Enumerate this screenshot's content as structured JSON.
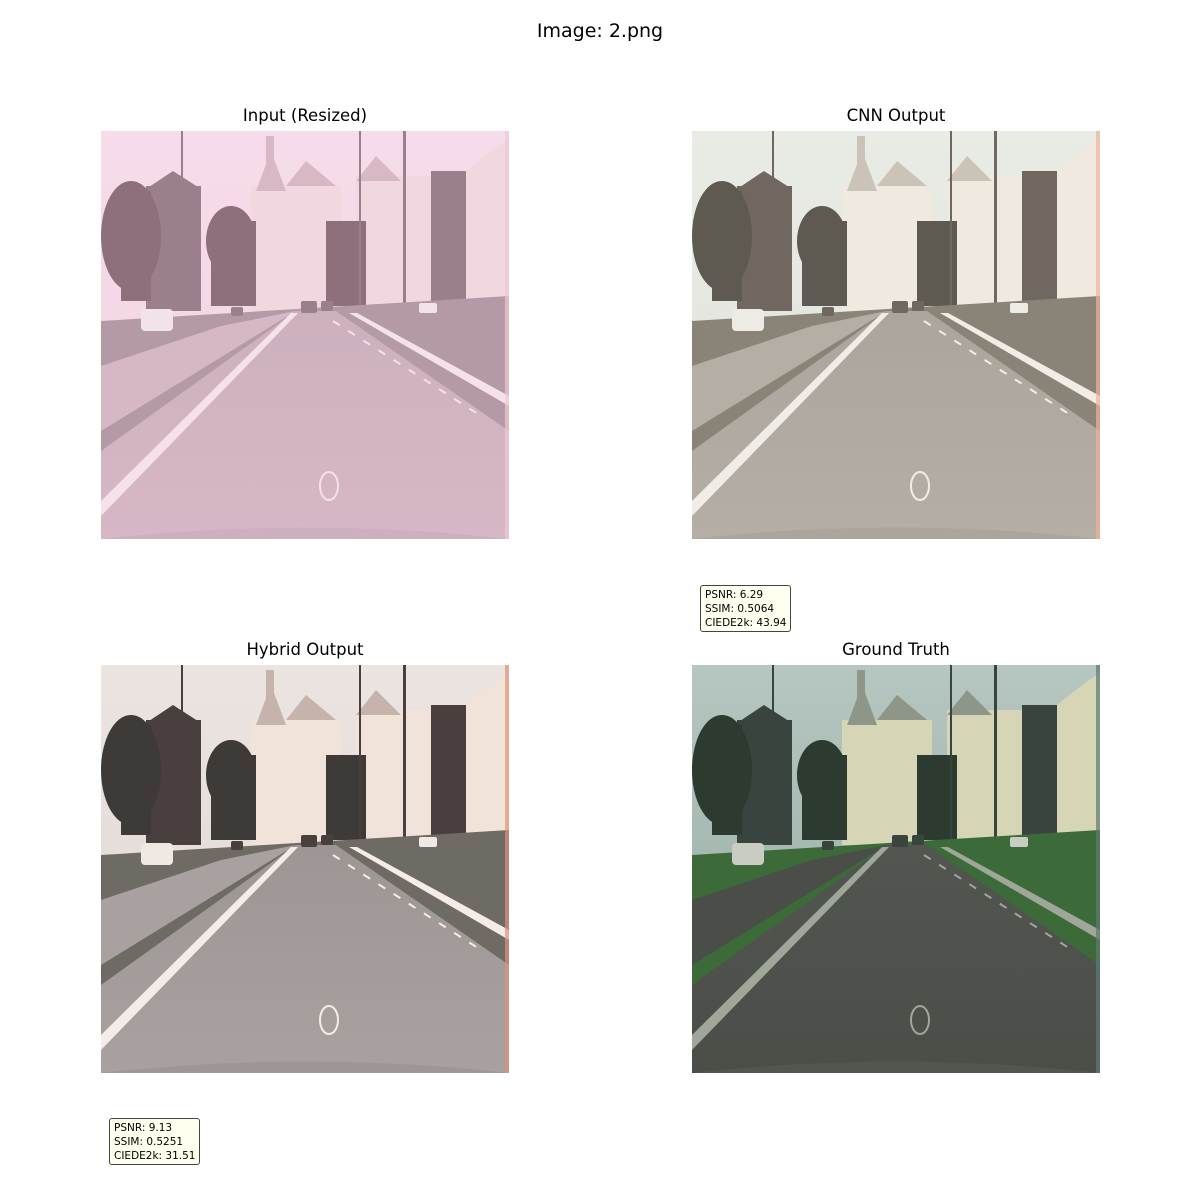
{
  "figure": {
    "title": "Image: 2.png"
  },
  "panels": [
    {
      "title": "Input (Resized)",
      "palette": {
        "sky": "#f6dcea",
        "sky2": "#f3d2e2",
        "road": "#d6b7c6",
        "road_far": "#cdb0be",
        "grass": "#b49aa6",
        "bld1": "#f0d7e0",
        "bld2": "#9c7f8c",
        "bld3": "#d9b8c6",
        "tree": "#8e6f7c",
        "line": "#f4e1ea",
        "car": "#f2e2ea",
        "edge": "#efc8d8"
      }
    },
    {
      "title": "CNN Output",
      "palette": {
        "sky": "#e9ebe5",
        "sky2": "#dfe2da",
        "road": "#b5aea5",
        "road_far": "#aca59d",
        "grass": "#8a8478",
        "bld1": "#efe9e0",
        "bld2": "#6f6760",
        "bld3": "#cbc3b8",
        "tree": "#5e5a52",
        "line": "#f1ede6",
        "car": "#eeebe4",
        "edge": "#f0b29a"
      },
      "metrics": {
        "psnr": "PSNR: 6.29",
        "ssim": "SSIM: 0.5064",
        "ciede": "CIEDE2k: 43.94"
      }
    },
    {
      "title": "Hybrid Output",
      "palette": {
        "sky": "#ebe4e1",
        "sky2": "#ded6d2",
        "road": "#a8a19f",
        "road_far": "#9d9694",
        "grass": "#6e6a64",
        "bld1": "#f1e3da",
        "bld2": "#4a3f3f",
        "bld3": "#c6b3ac",
        "tree": "#3e3a38",
        "line": "#f5ece7",
        "car": "#f0e8e3",
        "edge": "#e39177"
      },
      "metrics": {
        "psnr": "PSNR: 9.13",
        "ssim": "SSIM: 0.5251",
        "ciede": "CIEDE2k: 31.51"
      }
    },
    {
      "title": "Ground Truth",
      "palette": {
        "sky": "#b6c6c0",
        "sky2": "#93aaa1",
        "road": "#4b4d48",
        "road_far": "#525650",
        "grass": "#3c6a38",
        "bld1": "#d6d6b6",
        "bld2": "#3a443f",
        "bld3": "#8d9688",
        "tree": "#2c3a30",
        "line": "#9fa69a",
        "car": "#c9ccc2",
        "edge": "#5e7a70"
      }
    }
  ]
}
